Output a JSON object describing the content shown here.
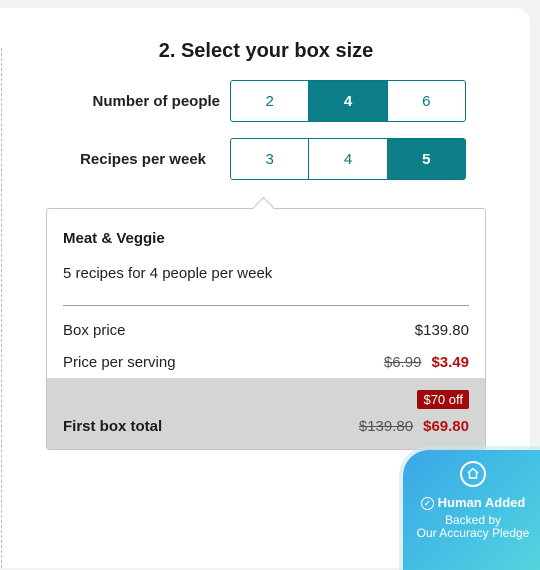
{
  "section_title": "2. Select your box size",
  "people": {
    "label": "Number of people",
    "options": [
      "2",
      "4",
      "6"
    ],
    "selected": "4"
  },
  "recipes": {
    "label": "Recipes per week",
    "options": [
      "3",
      "4",
      "5"
    ],
    "selected": "5"
  },
  "summary": {
    "plan_name": "Meat & Veggie",
    "description": "5 recipes for 4 people per week",
    "box_price_label": "Box price",
    "box_price": "$139.80",
    "per_serving_label": "Price per serving",
    "per_serving_old": "$6.99",
    "per_serving_new": "$3.49",
    "discount_badge": "$70 off",
    "first_box_label": "First box total",
    "first_box_old": "$139.80",
    "first_box_new": "$69.80"
  },
  "pledge": {
    "title": "Human Added",
    "line1": "Backed by",
    "line2": "Our Accuracy Pledge"
  },
  "colors": {
    "accent": "#0c7f88",
    "sale_red": "#b01010",
    "badge_red": "#9e0a0a"
  }
}
